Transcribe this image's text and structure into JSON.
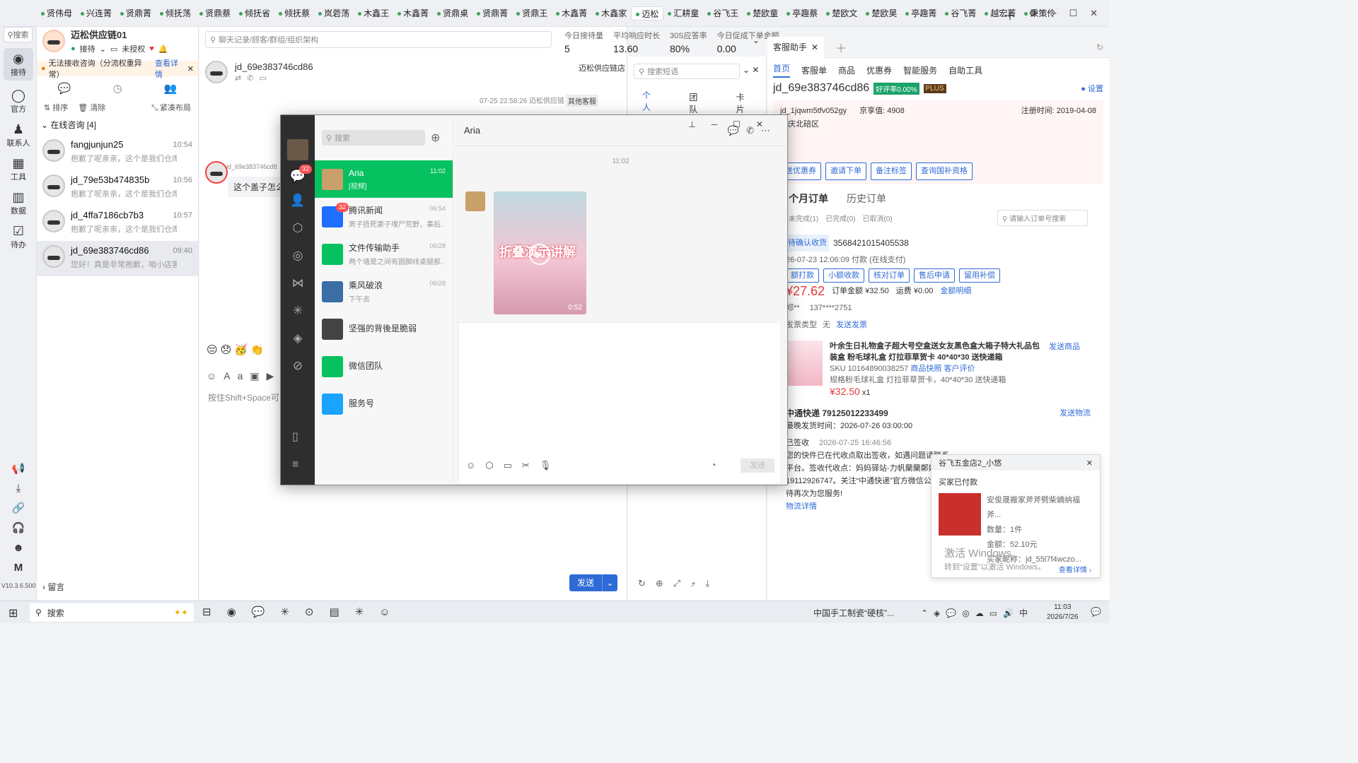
{
  "top_tabs": [
    "贤伟母",
    "兴连菁",
    "贤鼎菁",
    "倾抚荡",
    "贤鼎蔡",
    "倾抚省",
    "倾抚蔡",
    "岚菪荡",
    "木鑫王",
    "木鑫菁",
    "贤鼎桌",
    "贤鼎菁",
    "贤鼎王",
    "木鑫菁",
    "木鑫家",
    "迈松",
    "汇耕童",
    "谷飞王",
    "楚欧童",
    "亭趣蔡",
    "楚欧文",
    "楚欧昊",
    "亭趣菁",
    "谷飞菁",
    "越宏菁",
    "秉策伶"
  ],
  "active_tab": "迈松",
  "left_nav": {
    "search": "搜索",
    "items": [
      {
        "label": "接待",
        "icon": "chat-bubble-icon"
      },
      {
        "label": "官方",
        "icon": "message-icon"
      },
      {
        "label": "联系人",
        "icon": "person-icon"
      },
      {
        "label": "工具",
        "icon": "grid-icon"
      },
      {
        "label": "数据",
        "icon": "chart-icon"
      },
      {
        "label": "待办",
        "icon": "checkbox-icon"
      }
    ],
    "version": "V10.3.6.500"
  },
  "shop": {
    "name": "迈松供应链01",
    "status": "接待",
    "auth": "未授权",
    "warning": "无法接收咨询（分流权重异常）",
    "warning_link": "查看详情",
    "sort": "排序",
    "clear": "清除",
    "layout": "紧凑布局",
    "group": "在线咨询 [4]",
    "leave_msg": "留言"
  },
  "sessions": [
    {
      "name": "fangjunjun25",
      "time": "10:54",
      "preview": "抱歉了呢亲亲，这个是我们仓库打..."
    },
    {
      "name": "jd_79e53b474835b",
      "time": "10:56",
      "preview": "抱歉了呢亲亲，这个是我们仓库打..."
    },
    {
      "name": "jd_4ffa7186cb7b3",
      "time": "10:57",
      "preview": "抱歉了呢亲亲，这个是我们仓库打..."
    },
    {
      "name": "jd_69e383746cd86",
      "time": "09:40",
      "preview": "您好！真是非常抱歉，咱小店客服..."
    }
  ],
  "chat": {
    "search_placeholder": "聊天记录/顾客/群组/组织架构",
    "customer": "jd_69e383746cd86",
    "shop_label": "迈松供应链店",
    "msg_time": "07-25 22:58:26  迈松供应链",
    "other_cs": "其他客服",
    "msg_sender": "jd_69e383746cd8",
    "msg_text": "这个盖子怎么",
    "input_hint": "按住Shift+Space可",
    "send": "发送"
  },
  "stats": [
    {
      "label": "今日接待量",
      "value": "5"
    },
    {
      "label": "平均响应时长",
      "value": "13.60"
    },
    {
      "label": "30S应答率",
      "value": "80%"
    },
    {
      "label": "今日促成下单金额",
      "value": "0.00"
    }
  ],
  "quick": {
    "search_placeholder": "搜索短语",
    "tabs": [
      "个人",
      "团队",
      "卡片"
    ]
  },
  "right": {
    "tab_title": "客服助手",
    "nav": [
      "首页",
      "客服单",
      "商品",
      "优惠券",
      "智能服务",
      "自助工具"
    ],
    "customer": "jd_69e383746cd86",
    "good_rate": "好评率0.00%",
    "plus": "PLUS",
    "settings": "设置",
    "account": "jd_1jqwm5tfv052gy",
    "score_label": "京享值:",
    "score": "4908",
    "reg_label": "注册时间:",
    "reg": "2019-04-08",
    "region": "重庆北碚区",
    "f1": "无",
    "f2": "无",
    "actions": [
      "送优惠券",
      "邀请下单",
      "备注标签",
      "查询国补资格"
    ],
    "order_tabs": [
      "个月订单",
      "历史订单"
    ],
    "order_filter": [
      "未完成(1)",
      "已完成(0)",
      "已取消(0)"
    ],
    "order_search": "请输入订单号搜索",
    "order_status": "待确认收货",
    "order_no": "3568421015405538",
    "pay_time": "26-07-23 12:06:09 付款 (在线支付)",
    "order_actions": [
      "额打款",
      "小额收款",
      "核对订单",
      "售后申请",
      "留用补偿"
    ],
    "price": "¥27.62",
    "order_amount_label": "订单金额",
    "order_amount": "¥32.50",
    "freight_label": "运费",
    "freight": "¥0.00",
    "amount_detail": "金额明细",
    "receiver": "郑**",
    "phone": "137****2751",
    "invoice_label": "发票类型",
    "invoice": "无",
    "send_invoice": "发送发票",
    "product_title": "叶余生日礼物盒子超大号空盒送女友黑色盒大箱子特大礼品包装盒 粉毛球礼盒 灯拉菲草贺卡 40*40*30 送快递箱",
    "send_product": "发送商品",
    "sku": "SKU 10164890038257",
    "sku_links": "商品快照  客户评价",
    "spec": "规格粉毛球礼盒 灯拉菲草贺卡，40*40*30 送快递箱",
    "product_price": "¥32.50",
    "qty": "x1",
    "express": "中通快递 79125012233499",
    "send_logistics": "发送物流",
    "ship_time": "最晚发货时间：2026-07-26 03:00:00",
    "signed": "已签收",
    "signed_time": "2026-07-25 16:46:56",
    "logistics_text": "您的快件已在代收点取出签收，如遇问题请联系",
    "logistics_text2": "平台。签收代收点：妈妈驿站-力帆蘭蘭鄭妈妈",
    "logistics_text3": "19112926747。关注“中通快递”官方微信公",
    "logistics_text4": "待再次为您服务!",
    "logistics_detail": "物流详情"
  },
  "wechat": {
    "search": "搜索",
    "chat_title": "Aria",
    "msg_time": "11:02",
    "video_caption": "折叠演示讲解",
    "video_duration": "0:52",
    "send": "发送",
    "nav_badge": "32",
    "contacts": [
      {
        "name": "Aria",
        "time": "11:02",
        "preview": "[视频]",
        "color": "#c9a06a"
      },
      {
        "name": "腾讯新闻",
        "time": "06:54",
        "preview": "男子捂死妻子埋尸荒野，事后...",
        "color": "#1e6fff",
        "badge": "32"
      },
      {
        "name": "文件传输助手",
        "time": "06/28",
        "preview": "两个墙是之间有圆脚线桌腿那...",
        "color": "#07c160"
      },
      {
        "name": "乘风破浪",
        "time": "06/28",
        "preview": "下午去",
        "color": "#3a6ea5"
      },
      {
        "name": "坚强的背後是脆弱",
        "time": "",
        "preview": "",
        "color": "#444"
      },
      {
        "name": "微信团队",
        "time": "",
        "preview": "",
        "color": "#07c160"
      },
      {
        "name": "服务号",
        "time": "",
        "preview": "",
        "color": "#1aa3ff"
      }
    ]
  },
  "popup": {
    "title": "谷飞五金店2_小悠",
    "status": "买家已付款",
    "product": "安俊晟搬家斧斧劈柴嫡纳福斧...",
    "qty": "数量：1件",
    "amount": "金额：52.10元",
    "buyer": "买家昵称：jd_55l7f4wczo...",
    "detail": "查看详情",
    "activate": "激活 Windows",
    "activate2": "转到“设置”以激活 Windows。"
  },
  "taskbar": {
    "search": "搜索",
    "notice": "中国手工制瓷“硬核”...",
    "time": "11:03",
    "date": "2026/7/26",
    "ime": "中"
  }
}
